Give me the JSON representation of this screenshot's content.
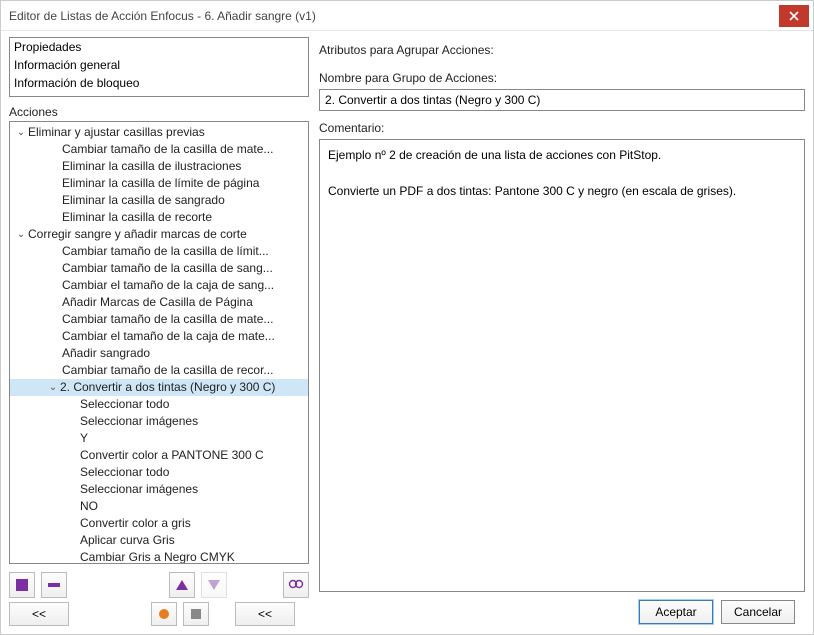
{
  "window": {
    "title": "Editor de Listas de Acción Enfocus - 6. Añadir sangre (v1)"
  },
  "propsList": {
    "items": [
      "Propiedades",
      "Información general",
      "Información de bloqueo"
    ]
  },
  "tree": {
    "label": "Acciones",
    "nodes": [
      {
        "level": 1,
        "exp": "v",
        "text": "Eliminar y ajustar casillas previas"
      },
      {
        "level": 2,
        "text": "Cambiar tamaño de la casilla de mate..."
      },
      {
        "level": 2,
        "text": "Eliminar la casilla de ilustraciones"
      },
      {
        "level": 2,
        "text": "Eliminar la casilla de límite de página"
      },
      {
        "level": 2,
        "text": "Eliminar la casilla de sangrado"
      },
      {
        "level": 2,
        "text": "Eliminar la casilla de recorte"
      },
      {
        "level": 1,
        "exp": "v",
        "text": "Corregir sangre y añadir marcas de corte"
      },
      {
        "level": 2,
        "text": "Cambiar tamaño de la casilla de límit..."
      },
      {
        "level": 2,
        "text": "Cambiar tamaño de la casilla de sang..."
      },
      {
        "level": 2,
        "text": "Cambiar el tamaño de la caja de sang..."
      },
      {
        "level": 2,
        "text": "Añadir Marcas de Casilla de Página"
      },
      {
        "level": 2,
        "text": "Cambiar tamaño de la casilla de mate..."
      },
      {
        "level": 2,
        "text": "Cambiar el tamaño de la caja de mate..."
      },
      {
        "level": 2,
        "text": "Añadir sangrado"
      },
      {
        "level": 2,
        "text": "Cambiar tamaño de la casilla de recor..."
      },
      {
        "level": 2,
        "exp": "v",
        "text": "2. Convertir a dos tintas (Negro y 300 C)",
        "selected": true
      },
      {
        "level": 3,
        "text": "Seleccionar todo"
      },
      {
        "level": 3,
        "text": "Seleccionar imágenes"
      },
      {
        "level": 3,
        "text": "Y"
      },
      {
        "level": 3,
        "text": "Convertir color a PANTONE 300 C"
      },
      {
        "level": 3,
        "text": "Seleccionar todo"
      },
      {
        "level": 3,
        "text": "Seleccionar imágenes"
      },
      {
        "level": 3,
        "text": "NO"
      },
      {
        "level": 3,
        "text": "Convertir color a gris"
      },
      {
        "level": 3,
        "text": "Aplicar curva Gris"
      },
      {
        "level": 3,
        "text": "Cambiar Gris a Negro CMYK"
      }
    ]
  },
  "right": {
    "heading": "Atributos para Agrupar Acciones:",
    "name_label": "Nombre para Grupo de Acciones:",
    "name_value": "2. Convertir a dos tintas (Negro y 300 C)",
    "comment_label": "Comentario:",
    "comment_value": "Ejemplo nº 2 de creación de una lista de acciones con PitStop.\n\nConvierte un PDF a dos tintas: Pantone 300 C y negro (en escala de grises)."
  },
  "nav": {
    "prev": "<<",
    "next": "<<"
  },
  "footer": {
    "ok": "Aceptar",
    "cancel": "Cancelar"
  }
}
